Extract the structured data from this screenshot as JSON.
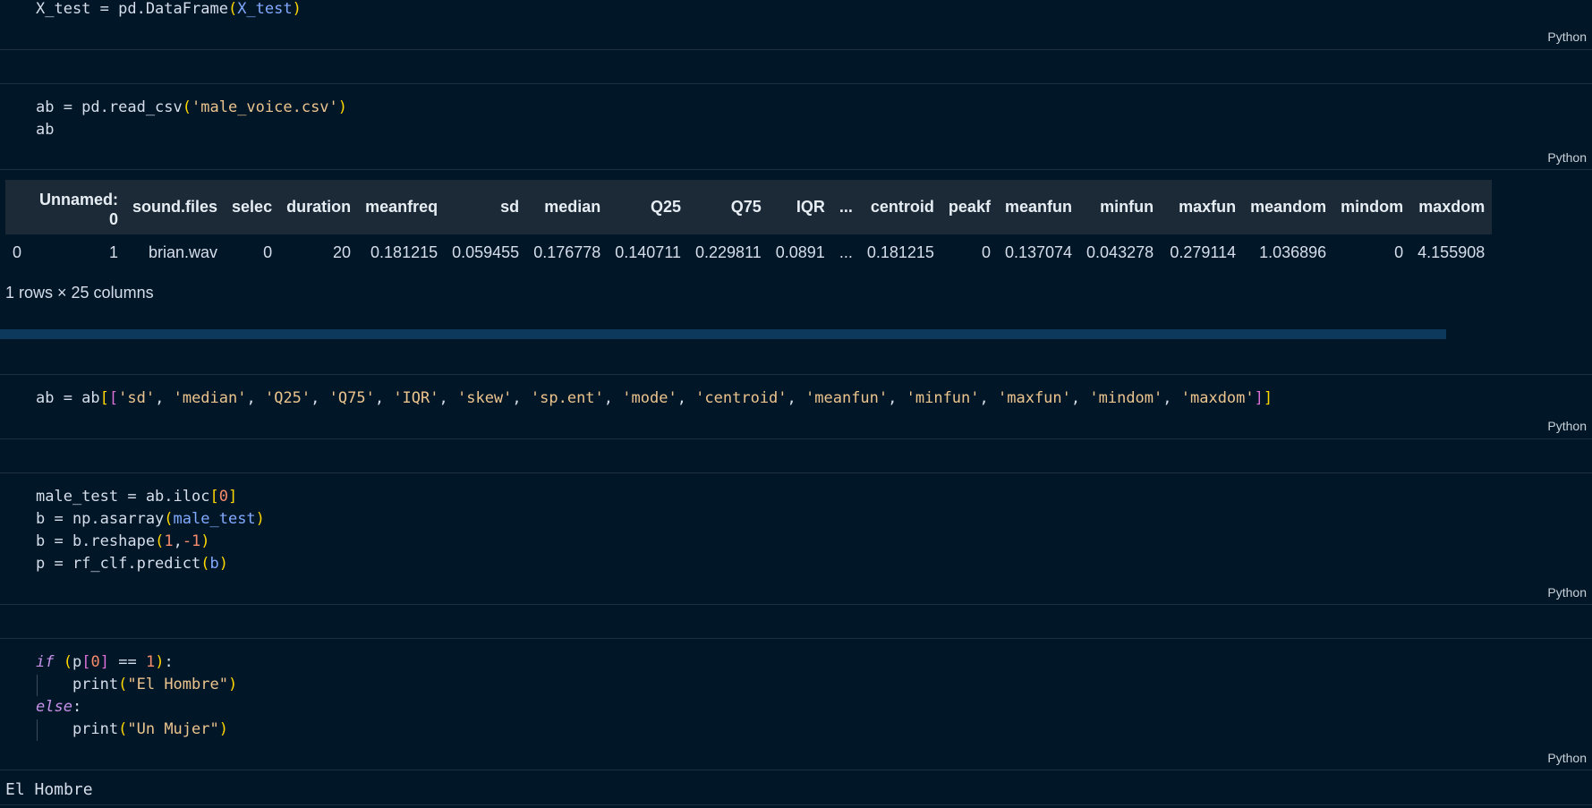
{
  "cells": [
    {
      "lang": "Python"
    },
    {
      "lang": "Python"
    },
    {
      "lang": "Python"
    },
    {
      "lang": "Python"
    },
    {
      "lang": "Python"
    }
  ],
  "dataframe": {
    "headers": [
      "",
      "Unnamed:\n0",
      "sound.files",
      "selec",
      "duration",
      "meanfreq",
      "sd",
      "median",
      "Q25",
      "Q75",
      "IQR",
      "...",
      "centroid",
      "peakf",
      "meanfun",
      "minfun",
      "maxfun",
      "meandom",
      "mindom",
      "maxdom"
    ],
    "rows": [
      [
        "0",
        "1",
        "brian.wav",
        "0",
        "20",
        "0.181215",
        "0.059455",
        "0.176778",
        "0.140711",
        "0.229811",
        "0.0891",
        "...",
        "0.181215",
        "0",
        "0.137074",
        "0.043278",
        "0.279114",
        "1.036896",
        "0",
        "4.155908"
      ]
    ],
    "shape_text": "1 rows × 25 columns"
  },
  "output_text": "El Hombre"
}
